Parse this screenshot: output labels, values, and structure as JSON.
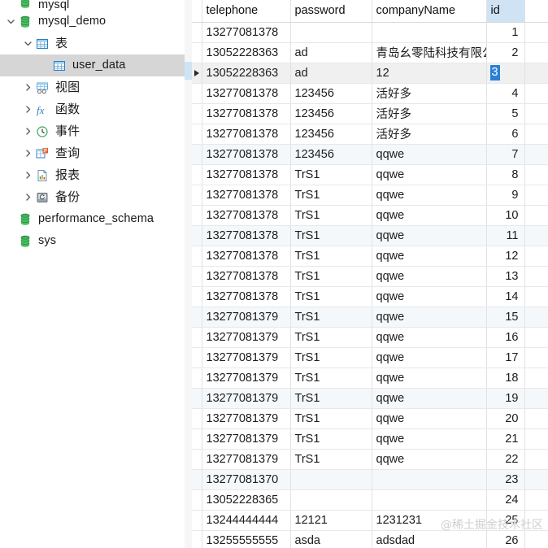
{
  "sidebar": {
    "scrollbar": {
      "visible": true
    },
    "items": [
      {
        "label": "mysql",
        "icon": "database-icon",
        "indent": 0,
        "twisty": "none",
        "selected": false,
        "clipped": true
      },
      {
        "label": "mysql_demo",
        "icon": "database-icon",
        "indent": 0,
        "twisty": "expanded",
        "selected": false
      },
      {
        "label": "表",
        "icon": "table-folder-icon",
        "indent": 1,
        "twisty": "expanded",
        "selected": false
      },
      {
        "label": "user_data",
        "icon": "table-icon",
        "indent": 2,
        "twisty": "none",
        "selected": true
      },
      {
        "label": "视图",
        "icon": "view-icon",
        "indent": 1,
        "twisty": "collapsed",
        "selected": false
      },
      {
        "label": "函数",
        "icon": "function-icon",
        "indent": 1,
        "twisty": "collapsed",
        "selected": false
      },
      {
        "label": "事件",
        "icon": "event-clock-icon",
        "indent": 1,
        "twisty": "collapsed",
        "selected": false
      },
      {
        "label": "查询",
        "icon": "query-icon",
        "indent": 1,
        "twisty": "collapsed",
        "selected": false
      },
      {
        "label": "报表",
        "icon": "report-icon",
        "indent": 1,
        "twisty": "collapsed",
        "selected": false
      },
      {
        "label": "备份",
        "icon": "backup-icon",
        "indent": 1,
        "twisty": "collapsed",
        "selected": false
      },
      {
        "label": "performance_schema",
        "icon": "database-icon",
        "indent": 0,
        "twisty": "none",
        "selected": false
      },
      {
        "label": "sys",
        "icon": "database-icon",
        "indent": 0,
        "twisty": "none",
        "selected": false
      }
    ]
  },
  "grid": {
    "columns": [
      {
        "key": "telephone",
        "label": "telephone",
        "align": "left"
      },
      {
        "key": "password",
        "label": "password",
        "align": "left"
      },
      {
        "key": "companyName",
        "label": "companyName",
        "align": "left"
      },
      {
        "key": "id",
        "label": "id",
        "align": "right",
        "highlighted": true
      }
    ],
    "selected_cell": {
      "row_index": 2,
      "column": "id",
      "value": "3"
    },
    "current_row_index": 2,
    "rows": [
      {
        "telephone": "13277081378",
        "password": "",
        "companyName": "",
        "id": "1"
      },
      {
        "telephone": "13052228363",
        "password": "ad",
        "companyName": "青岛幺零陆科技有限公司",
        "id": "2"
      },
      {
        "telephone": "13052228363",
        "password": "ad",
        "companyName": "12",
        "id": "3"
      },
      {
        "telephone": "13277081378",
        "password": "123456",
        "companyName": "活好多",
        "id": "4"
      },
      {
        "telephone": "13277081378",
        "password": "123456",
        "companyName": "活好多",
        "id": "5"
      },
      {
        "telephone": "13277081378",
        "password": "123456",
        "companyName": "活好多",
        "id": "6"
      },
      {
        "telephone": "13277081378",
        "password": "123456",
        "companyName": "qqwe",
        "id": "7"
      },
      {
        "telephone": "13277081378",
        "password": "TrS1",
        "companyName": "qqwe",
        "id": "8"
      },
      {
        "telephone": "13277081378",
        "password": "TrS1",
        "companyName": "qqwe",
        "id": "9"
      },
      {
        "telephone": "13277081378",
        "password": "TrS1",
        "companyName": "qqwe",
        "id": "10"
      },
      {
        "telephone": "13277081378",
        "password": "TrS1",
        "companyName": "qqwe",
        "id": "11"
      },
      {
        "telephone": "13277081378",
        "password": "TrS1",
        "companyName": "qqwe",
        "id": "12"
      },
      {
        "telephone": "13277081378",
        "password": "TrS1",
        "companyName": "qqwe",
        "id": "13"
      },
      {
        "telephone": "13277081378",
        "password": "TrS1",
        "companyName": "qqwe",
        "id": "14"
      },
      {
        "telephone": "13277081379",
        "password": "TrS1",
        "companyName": "qqwe",
        "id": "15"
      },
      {
        "telephone": "13277081379",
        "password": "TrS1",
        "companyName": "qqwe",
        "id": "16"
      },
      {
        "telephone": "13277081379",
        "password": "TrS1",
        "companyName": "qqwe",
        "id": "17"
      },
      {
        "telephone": "13277081379",
        "password": "TrS1",
        "companyName": "qqwe",
        "id": "18"
      },
      {
        "telephone": "13277081379",
        "password": "TrS1",
        "companyName": "qqwe",
        "id": "19"
      },
      {
        "telephone": "13277081379",
        "password": "TrS1",
        "companyName": "qqwe",
        "id": "20"
      },
      {
        "telephone": "13277081379",
        "password": "TrS1",
        "companyName": "qqwe",
        "id": "21"
      },
      {
        "telephone": "13277081379",
        "password": "TrS1",
        "companyName": "qqwe",
        "id": "22"
      },
      {
        "telephone": "13277081370",
        "password": "",
        "companyName": "",
        "id": "23"
      },
      {
        "telephone": "13052228365",
        "password": "",
        "companyName": "",
        "id": "24"
      },
      {
        "telephone": "13244444444",
        "password": "12121",
        "companyName": "1231231",
        "id": "25"
      },
      {
        "telephone": "13255555555",
        "password": "asda",
        "companyName": "adsdad",
        "id": "26"
      }
    ]
  },
  "watermark": {
    "text": "@稀土掘金技术社区"
  },
  "colors": {
    "selection_blue": "#2b7fd4",
    "header_highlight": "#cfe3f5",
    "tree_selection": "#d6d6d6",
    "alt_row": "#f4f8fb"
  }
}
